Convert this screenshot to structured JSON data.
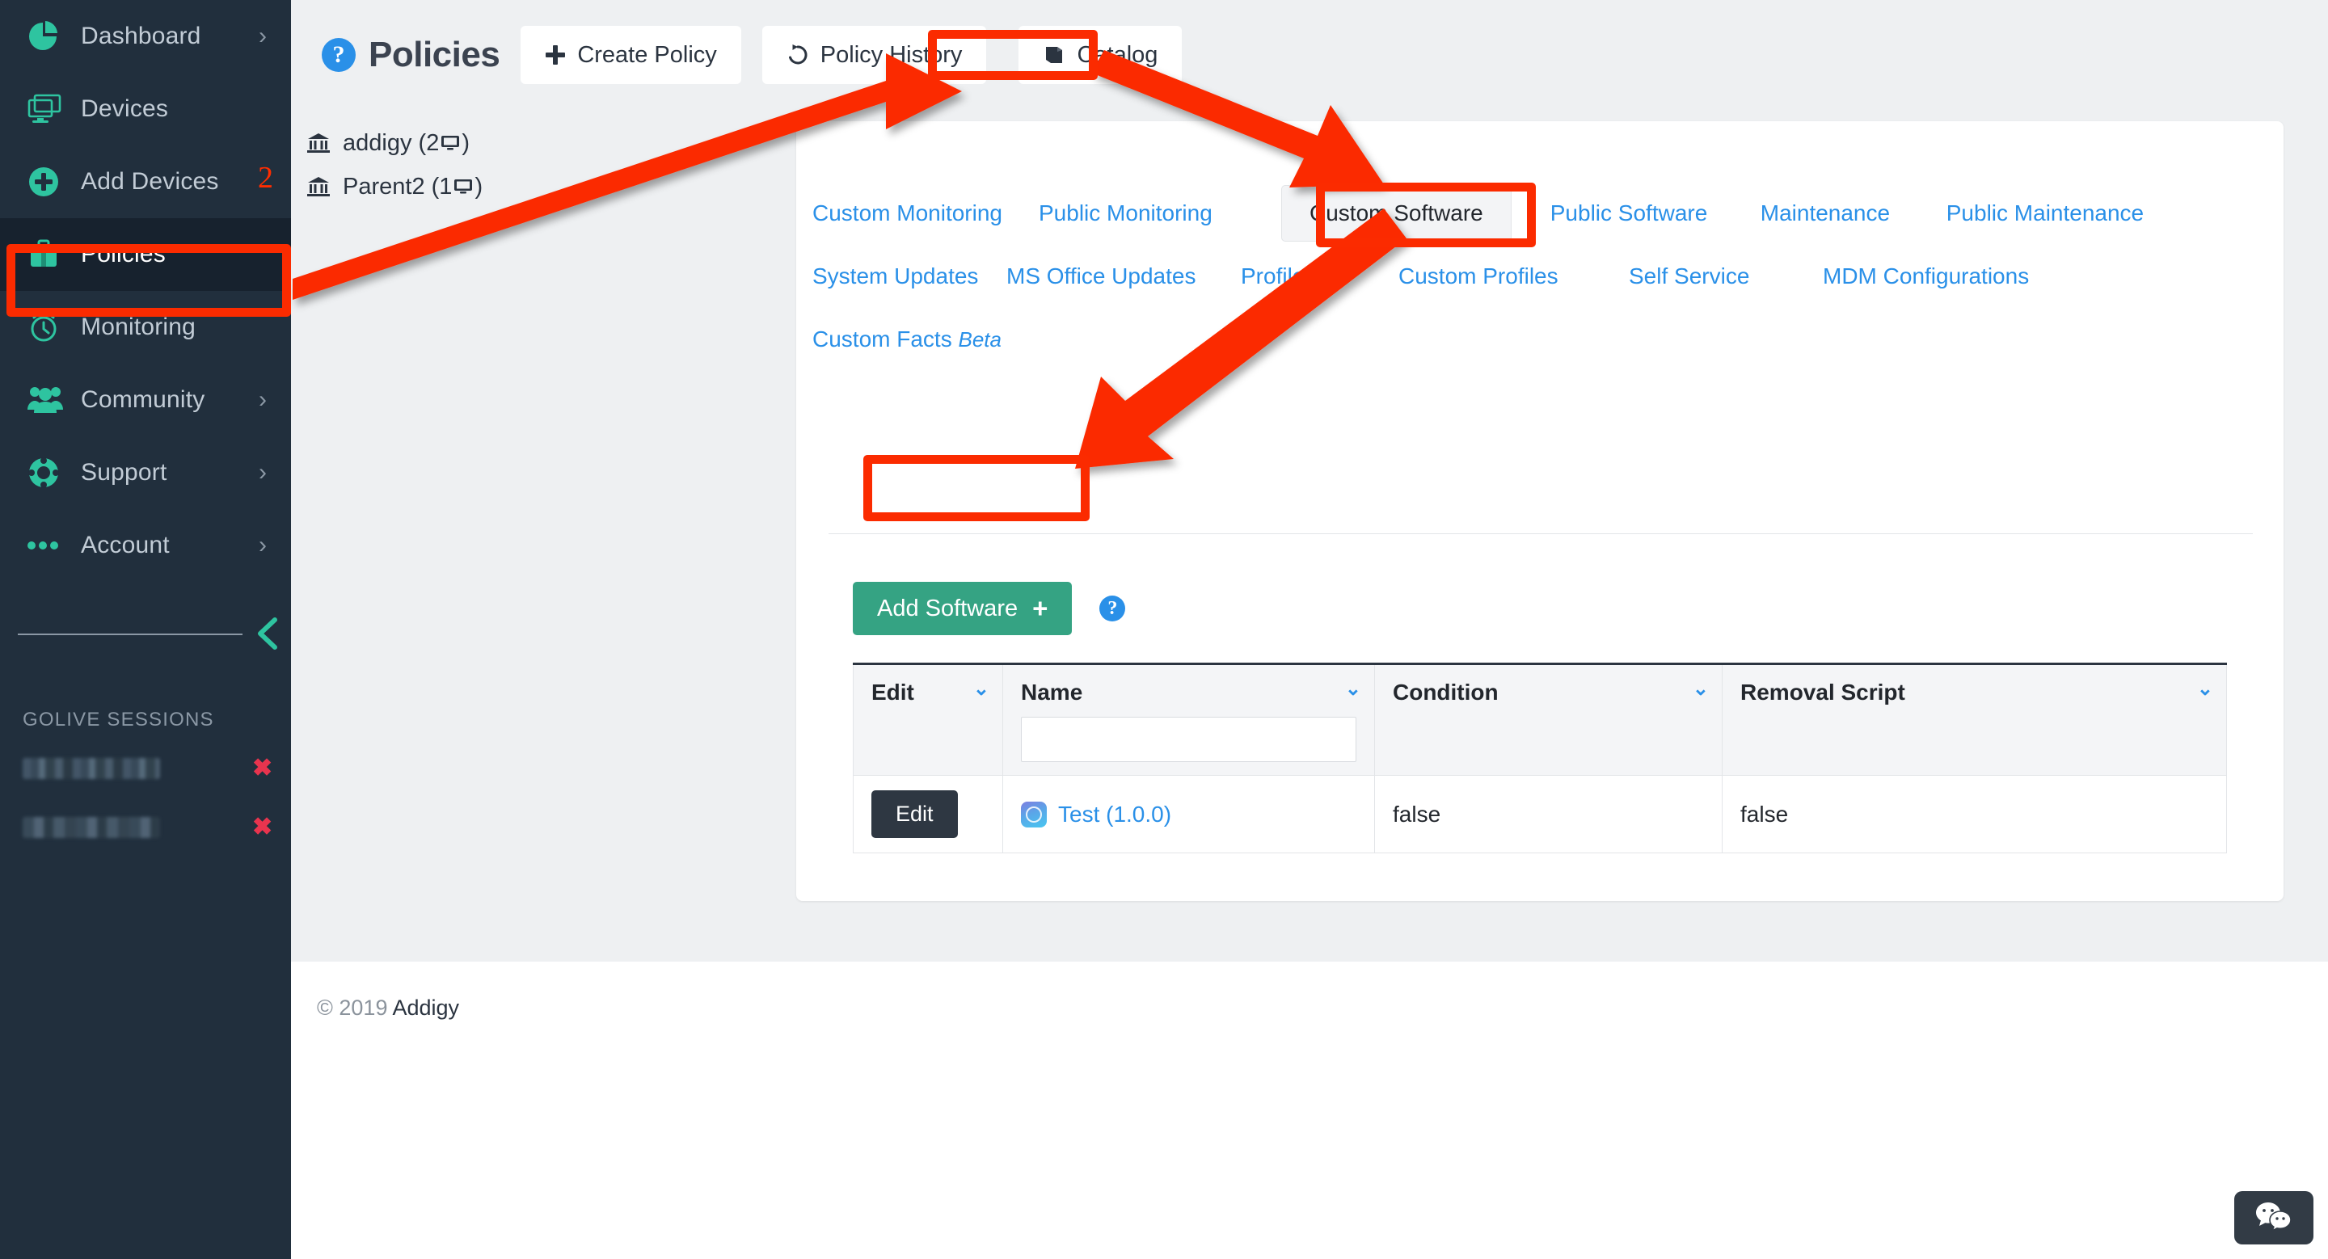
{
  "sidebar": {
    "items": [
      {
        "label": "Dashboard",
        "icon": "pie-chart-icon",
        "chevron": "›",
        "active": false
      },
      {
        "label": "Devices",
        "icon": "monitor-icon",
        "chevron": "",
        "active": false
      },
      {
        "label": "Add Devices",
        "icon": "plus-circle-icon",
        "chevron": "",
        "active": false,
        "badge": "2"
      },
      {
        "label": "Policies",
        "icon": "briefcase-icon",
        "chevron": "",
        "active": true
      },
      {
        "label": "Monitoring",
        "icon": "alarm-clock-icon",
        "chevron": "",
        "active": false
      },
      {
        "label": "Community",
        "icon": "people-icon",
        "chevron": "›",
        "active": false
      },
      {
        "label": "Support",
        "icon": "lifebuoy-icon",
        "chevron": "›",
        "active": false
      },
      {
        "label": "Account",
        "icon": "ellipsis-icon",
        "chevron": "›",
        "active": false
      }
    ],
    "collapse_icon": "chevron-left-icon",
    "golive_title": "GOLIVE SESSIONS",
    "golive_sessions": [
      {
        "name": "",
        "redacted": true,
        "close_label": "✖"
      },
      {
        "name": "",
        "redacted": true,
        "close_label": "✖"
      }
    ]
  },
  "header": {
    "help_icon_label": "?",
    "title": "Policies",
    "buttons": [
      {
        "label": "Create Policy",
        "icon": "plus-icon",
        "name": "create-policy-button"
      },
      {
        "label": "Policy History",
        "icon": "history-icon",
        "name": "policy-history-button"
      },
      {
        "label": "Catalog",
        "icon": "book-icon",
        "name": "catalog-button"
      }
    ]
  },
  "tree": {
    "items": [
      {
        "icon": "bank-icon",
        "label": "addigy",
        "count": "2",
        "device_icon": "monitor-small-icon"
      },
      {
        "icon": "bank-icon",
        "label": "Parent2",
        "count": "1",
        "device_icon": "monitor-small-icon"
      }
    ]
  },
  "card": {
    "tabs_row1": [
      {
        "label": "Custom Monitoring",
        "active": false
      },
      {
        "label": "Public Monitoring",
        "active": false
      },
      {
        "label": "Custom Software",
        "active": true
      },
      {
        "label": "Public Software",
        "active": false
      },
      {
        "label": "Maintenance",
        "active": false
      },
      {
        "label": "Public Maintenance",
        "active": false
      }
    ],
    "tabs_row2": [
      {
        "label": "System Updates",
        "active": false
      },
      {
        "label": "MS Office Updates",
        "active": false
      },
      {
        "label": "Profiles",
        "active": false
      },
      {
        "label": "Custom Profiles",
        "active": false
      },
      {
        "label": "Self Service",
        "active": false
      },
      {
        "label": "MDM Configurations",
        "active": false
      }
    ],
    "tabs_row3": [
      {
        "label": "Custom Facts",
        "badge": "Beta",
        "active": false
      }
    ],
    "add_software_label": "Add Software",
    "add_software_plus": "+",
    "add_software_help": "?",
    "table": {
      "columns": [
        {
          "label": "Edit",
          "caret": "⌄",
          "has_filter": false
        },
        {
          "label": "Name",
          "caret": "⌄",
          "has_filter": true,
          "filter_value": ""
        },
        {
          "label": "Condition",
          "caret": "⌄",
          "has_filter": false
        },
        {
          "label": "Removal Script",
          "caret": "⌄",
          "has_filter": false
        }
      ],
      "rows": [
        {
          "edit_label": "Edit",
          "app_icon": "app-icon",
          "name": "Test (1.0.0)",
          "condition": "false",
          "removal_script": "false"
        }
      ]
    }
  },
  "footer": {
    "copyright": "© 2019 ",
    "brand": "Addigy"
  },
  "chat": {
    "icon": "chat-bubbles-icon"
  },
  "colors": {
    "sidebar_bg": "#212f3d",
    "sidebar_active": "#17222e",
    "accent_green": "#2ec4a0",
    "button_green": "#35a383",
    "link_blue": "#2a90e8",
    "annotation_red": "#fb2b00",
    "page_bg": "#eef0f2",
    "close_red": "#e8344e"
  }
}
